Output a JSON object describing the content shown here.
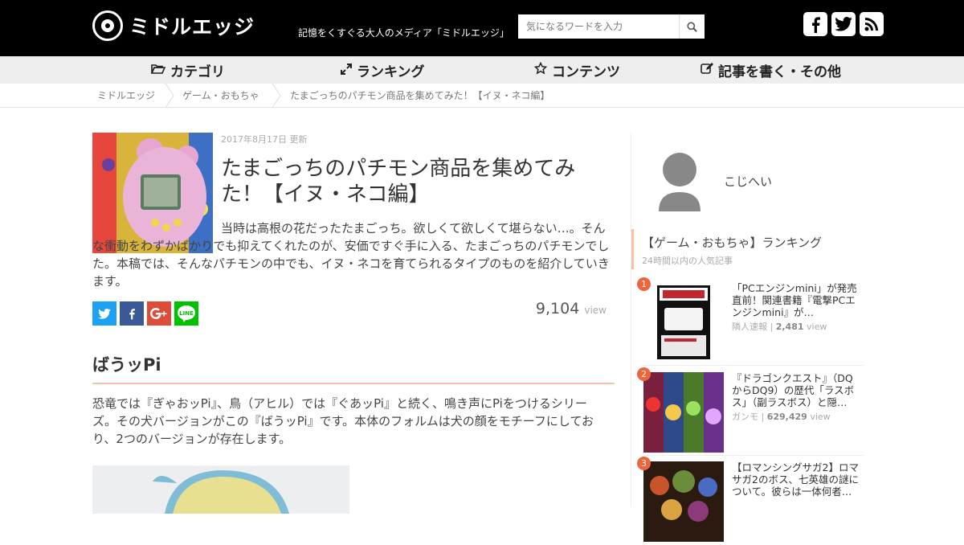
{
  "header": {
    "logo_text": "ミドルエッジ",
    "tagline": "記憶をくすぐる大人のメディア「ミドルエッジ」",
    "search_placeholder": "気になるワードを入力",
    "social": [
      "facebook-icon",
      "twitter-icon",
      "rss-icon"
    ]
  },
  "nav": {
    "items": [
      {
        "label": "カテゴリ",
        "icon": "folder-open-icon"
      },
      {
        "label": "ランキング",
        "icon": "expand-icon"
      },
      {
        "label": "コンテンツ",
        "icon": "star-icon"
      },
      {
        "label": "記事を書く・その他",
        "icon": "edit-icon"
      }
    ]
  },
  "breadcrumb": [
    "ミドルエッジ",
    "ゲーム・おもちゃ",
    "たまごっちのパチモン商品を集めてみた！【イヌ・ネコ編】"
  ],
  "article": {
    "date": "2017年8月17日 更新",
    "title": "たまごっちのパチモン商品を集めてみた！【イヌ・ネコ編】",
    "lead_1": "当時は高根の花だったたまごっち。欲しくて欲しくて堪らない…。そんな衝動をわずかばかりでも抑えてくれたのが、安価ですぐ手に入る、たまごっちのパチモンでした。本稿では、そんなパチモンの中でも、イヌ・ネコを育てられるタイプのものを紹介していきます。",
    "views_count": "9,104",
    "views_unit": "view",
    "share_buttons": [
      "twitter",
      "facebook",
      "google-plus",
      "line"
    ],
    "section_heading": "ばうッPi",
    "section_body": "恐竜では『ぎゃおッPi』、鳥（アヒル）では『ぐあッPi』と続く、鳴き声にPiをつけるシリーズ。その犬バージョンがこの『ばうッPi』です。本体のフォルムは犬の顔をモチーフにしており、2つのバージョンが存在します。"
  },
  "sidebar": {
    "author_name": "こじへい",
    "ranking_title": "【ゲーム・おもちゃ】ランキング",
    "ranking_sub": "24時間以内の人気記事",
    "items": [
      {
        "rank": "1",
        "title": "「PCエンジンmini」が発売直前！関連書籍『電撃PCエンジンmini』が…",
        "source": "隣人速報",
        "views": "2,481",
        "unit": "view"
      },
      {
        "rank": "2",
        "title": "『ドラゴンクエスト』（DQからDQ9）の歴代「ラスボス」（副ラスボス）と隠…",
        "source": "ガンモ",
        "views": "629,429",
        "unit": "view"
      },
      {
        "rank": "3",
        "title": "【ロマンシングサガ2】ロマサガ2のボス、七英雄の謎について。彼らは一体何者…",
        "source": "",
        "views": "",
        "unit": ""
      }
    ]
  }
}
